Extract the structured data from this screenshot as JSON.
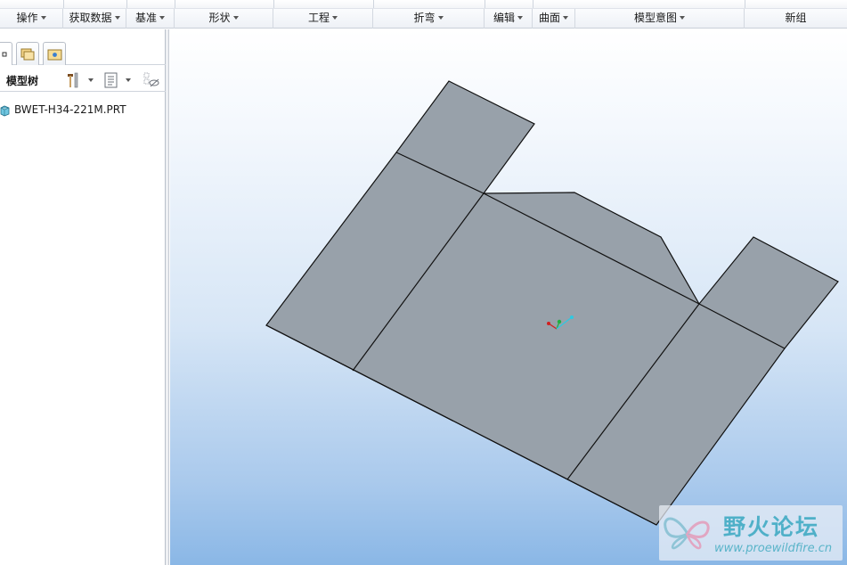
{
  "ribbon": {
    "groups": [
      {
        "label": "操作"
      },
      {
        "label": "获取数据"
      },
      {
        "label": "基准"
      },
      {
        "label": "形状"
      },
      {
        "label": "工程"
      },
      {
        "label": "折弯"
      },
      {
        "label": "编辑"
      },
      {
        "label": "曲面"
      },
      {
        "label": "模型意图"
      },
      {
        "label": "新组"
      }
    ]
  },
  "left_panel": {
    "tree_title": "模型树",
    "tree_items": [
      {
        "label": "BWET-H34-221M.PRT",
        "icon": "part-icon"
      }
    ]
  },
  "watermark": {
    "title": "野火论坛",
    "url": "www.proewildfire.cn"
  },
  "colors": {
    "model_fill": "#98a1aa",
    "model_edge": "#111111",
    "viewport_top": "#ffffff",
    "viewport_bottom": "#8ab7e6",
    "watermark_text": "#4fb0c8"
  }
}
